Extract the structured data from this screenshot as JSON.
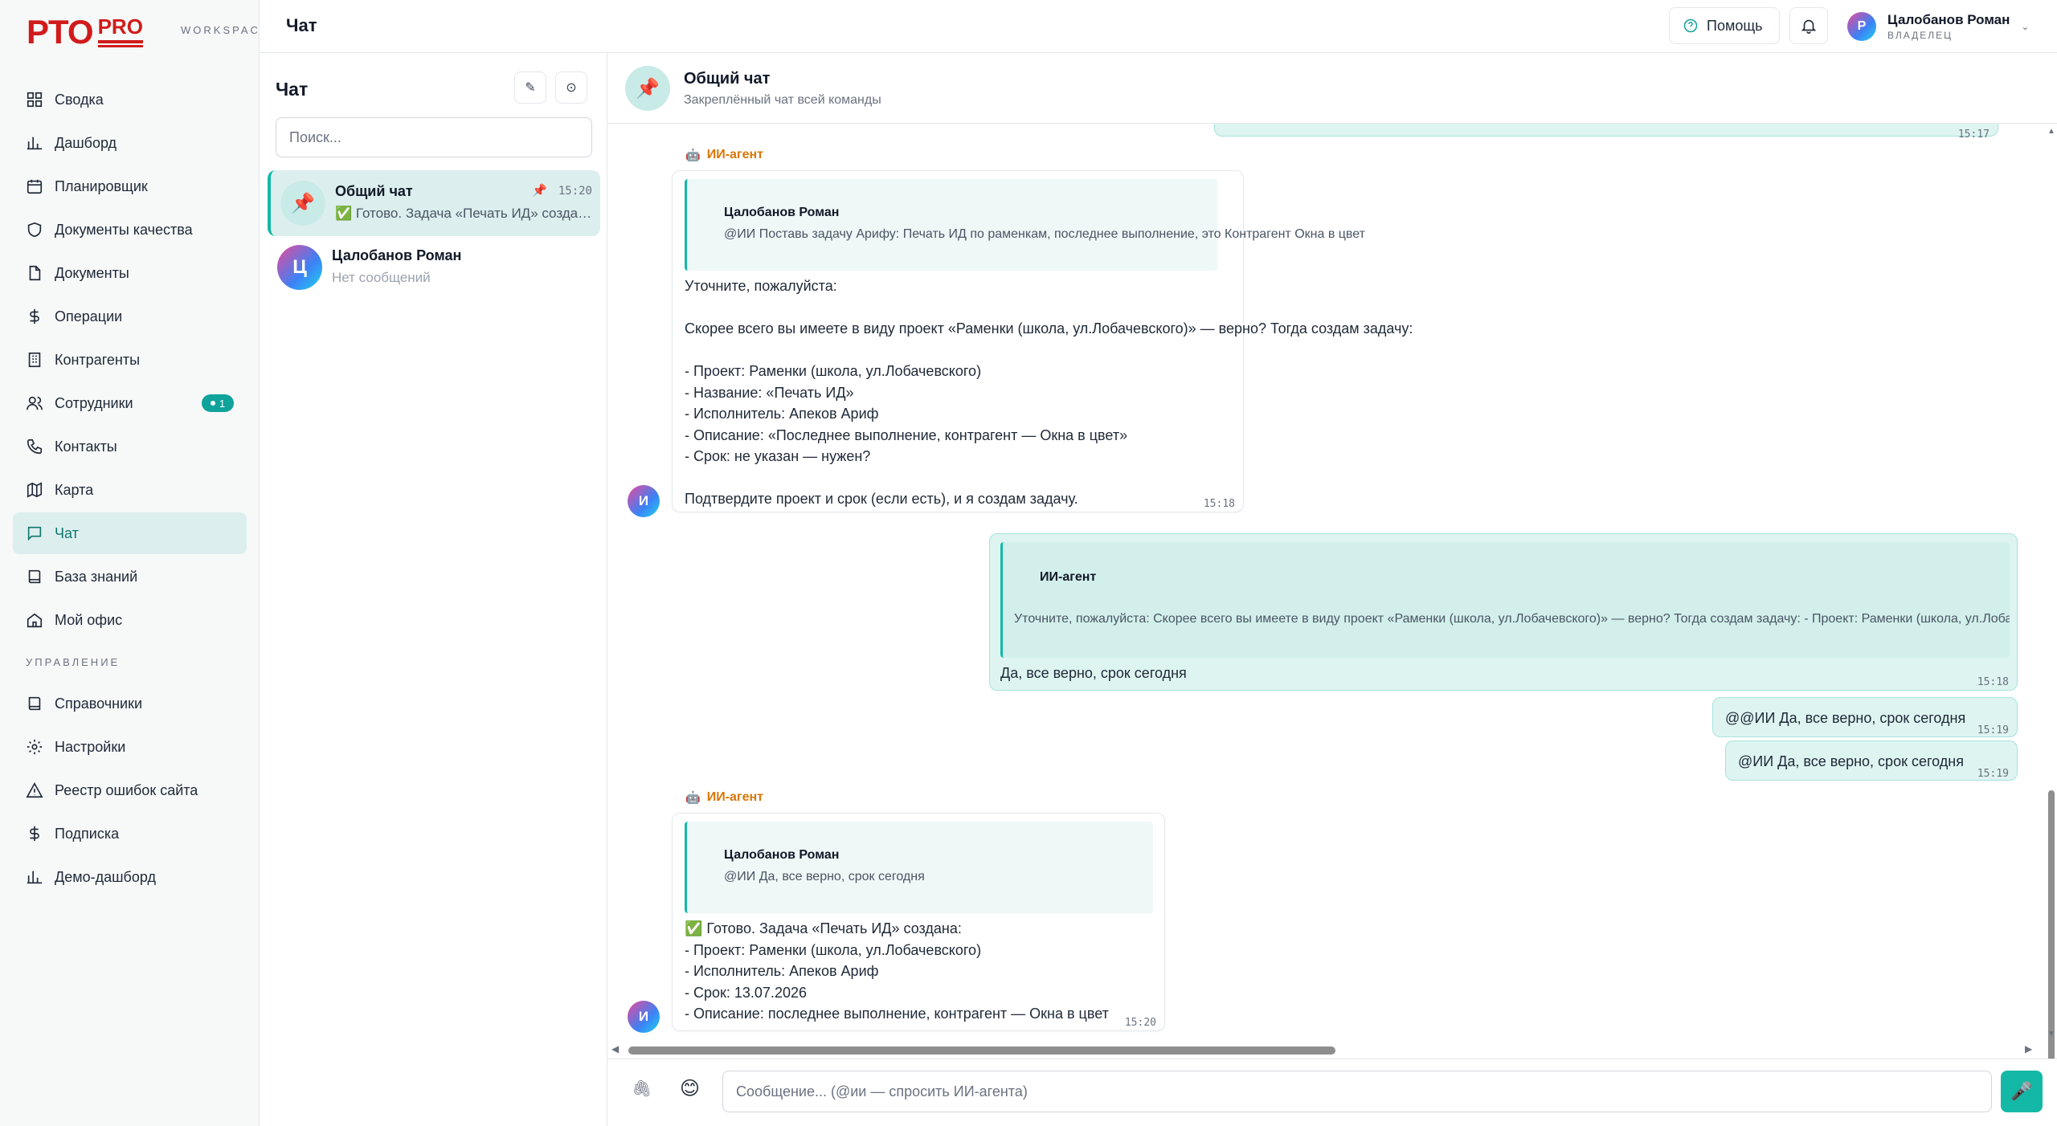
{
  "brand": {
    "logo_main": "PTO",
    "logo_pro": "PRO",
    "workspace": "WORKSPACE"
  },
  "nav": {
    "items": [
      {
        "label": "Сводка",
        "icon": "grid-icon"
      },
      {
        "label": "Дашборд",
        "icon": "bar-chart-icon"
      },
      {
        "label": "Планировщик",
        "icon": "calendar-icon"
      },
      {
        "label": "Документы качества",
        "icon": "shield-icon"
      },
      {
        "label": "Документы",
        "icon": "document-icon"
      },
      {
        "label": "Операции",
        "icon": "dollar-icon"
      },
      {
        "label": "Контрагенты",
        "icon": "building-icon"
      },
      {
        "label": "Сотрудники",
        "icon": "users-icon",
        "badge": "1"
      },
      {
        "label": "Контакты",
        "icon": "phone-icon"
      },
      {
        "label": "Карта",
        "icon": "map-icon"
      },
      {
        "label": "Чат",
        "icon": "chat-icon",
        "active": true
      },
      {
        "label": "База знаний",
        "icon": "book-icon"
      },
      {
        "label": "Мой офис",
        "icon": "house-icon"
      }
    ],
    "section_label": "УПРАВЛЕНИЕ",
    "admin_items": [
      {
        "label": "Справочники",
        "icon": "book-icon"
      },
      {
        "label": "Настройки",
        "icon": "gear-icon"
      },
      {
        "label": "Реестр ошибок сайта",
        "icon": "warning-icon"
      },
      {
        "label": "Подписка",
        "icon": "dollar-icon"
      },
      {
        "label": "Демо-дашборд",
        "icon": "bar-chart-icon"
      }
    ]
  },
  "header": {
    "title": "Чат",
    "help_label": "Помощь",
    "user": {
      "initial": "Р",
      "name": "Цалобанов Роман",
      "role": "ВЛАДЕЛЕЦ"
    }
  },
  "chat_list": {
    "title": "Чат",
    "search_placeholder": "Поиск...",
    "conversations": [
      {
        "name": "Общий чат",
        "last": "✅ Готово. Задача «Печать ИД» создана:",
        "time": "15:20",
        "pinned": true,
        "active": true
      },
      {
        "name": "Цалобанов Роман",
        "initial": "Ц",
        "last": "Нет сообщений"
      }
    ]
  },
  "chat": {
    "title": "Общий чат",
    "subtitle": "Закреплённый чат всей команды",
    "messages": {
      "m1": {
        "sender": "ИИ-агент",
        "avatar": "И",
        "quote_author": "Цалобанов Роман",
        "quote_text": "@ИИ Поставь задачу Арифу: Печать ИД по раменкам, последнее выполнение, это Контрагент Окна в цвет",
        "text": "Уточните, пожалуйста:\n\nСкорее всего вы имеете в виду проект «Раменки (школа, ул.Лобачевского)» — верно? Тогда создам задачу:\n\n- Проект: Раменки (школа, ул.Лобачевского)\n- Название: «Печать ИД»\n- Исполнитель: Апеков Ариф\n- Описание: «Последнее выполнение, контрагент — Окна в цвет»\n- Срок: не указан — нужен?\n\nПодтвердите проект и срок (если есть), и я создам задачу.",
        "time": "15:18"
      },
      "m2": {
        "quote_author": "ИИ-агент",
        "quote_text": "Уточните, пожалуйста: Скорее всего вы имеете в виду проект «Раменки (школа, ул.Лобачевского)» — верно? Тогда создам задачу: - Проект: Раменки (школа, ул.Лобачевского)",
        "text": "Да, все верно, срок сегодня",
        "time": "15:18"
      },
      "m3": {
        "text": "@@ИИ Да, все верно, срок сегодня",
        "time": "15:19"
      },
      "m4": {
        "text": "@ИИ Да, все верно, срок сегодня",
        "time": "15:19"
      },
      "m5": {
        "sender": "ИИ-агент",
        "avatar": "И",
        "quote_author": "Цалобанов Роман",
        "quote_text": "@ИИ Да, все верно, срок сегодня",
        "text": "✅ Готово. Задача «Печать ИД» создана:\n- Проект: Раменки (школа, ул.Лобачевского)\n- Исполнитель: Апеков Ариф\n- Срок: 13.07.2026\n- Описание: последнее выполнение, контрагент — Окна в цвет",
        "time": "15:20"
      },
      "top_time": "15:17"
    }
  },
  "composer": {
    "placeholder": "Сообщение... (@ии — спросить ИИ-агента)"
  },
  "colors": {
    "brand_red": "#d11b1b",
    "accent_teal": "#14b8a6",
    "active_bg": "#dcefee",
    "agent_orange": "#d97706"
  }
}
